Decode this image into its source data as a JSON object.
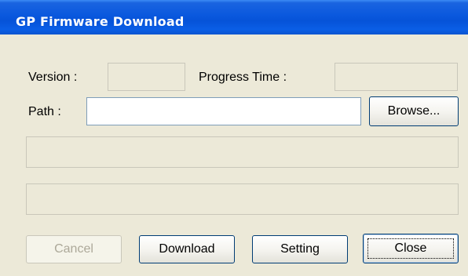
{
  "window": {
    "title": "GP Firmware Download"
  },
  "form": {
    "version_label": "Version :",
    "version_value": "",
    "progress_time_label": "Progress Time :",
    "progress_time_value": "",
    "path_label": "Path :",
    "path_value": "",
    "browse_label": "Browse...",
    "status_line_1": "",
    "status_line_2": ""
  },
  "buttons": {
    "cancel": {
      "label": "Cancel",
      "enabled": false
    },
    "download": {
      "label": "Download",
      "enabled": true
    },
    "setting": {
      "label": "Setting",
      "enabled": true
    },
    "close": {
      "label": "Close",
      "enabled": true,
      "default": true
    }
  },
  "colors": {
    "titlebar": "#0a58de",
    "title_text": "#ffffff",
    "dialog_face": "#ece9d8",
    "button_border": "#003c74",
    "disabled_text": "#aca899"
  }
}
